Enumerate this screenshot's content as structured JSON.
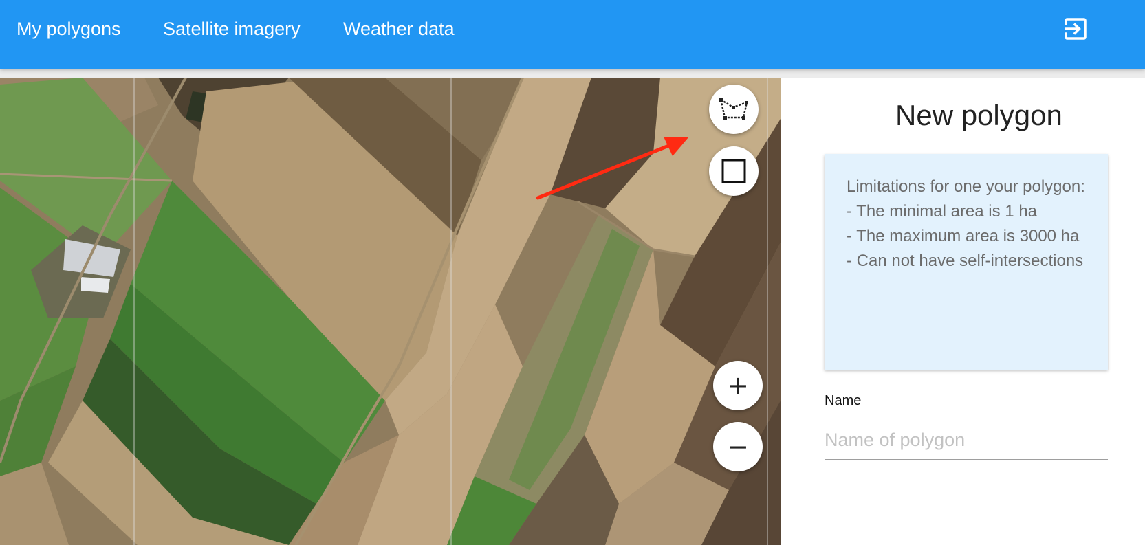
{
  "header": {
    "nav": [
      {
        "label": "My polygons"
      },
      {
        "label": "Satellite imagery"
      },
      {
        "label": "Weather data"
      }
    ],
    "logout_icon": "logout-icon"
  },
  "map": {
    "tools": [
      {
        "icon": "draw-polygon-icon"
      },
      {
        "icon": "draw-rectangle-icon"
      }
    ],
    "zoom_in_label": "+",
    "zoom_out_label": "−",
    "annotation": "red-arrow",
    "colors": {
      "arrow": "#ff2a12"
    }
  },
  "panel": {
    "title": "New polygon",
    "limitations": "Limitations for one your polygon:\n- The minimal area is 1 ha\n- The maximum area is 3000 ha\n- Can not have self-intersections",
    "name_label": "Name",
    "name_value": "",
    "name_placeholder": "Name of polygon"
  },
  "colors": {
    "header": "#2196f3",
    "info_box": "#e3f2fd"
  }
}
